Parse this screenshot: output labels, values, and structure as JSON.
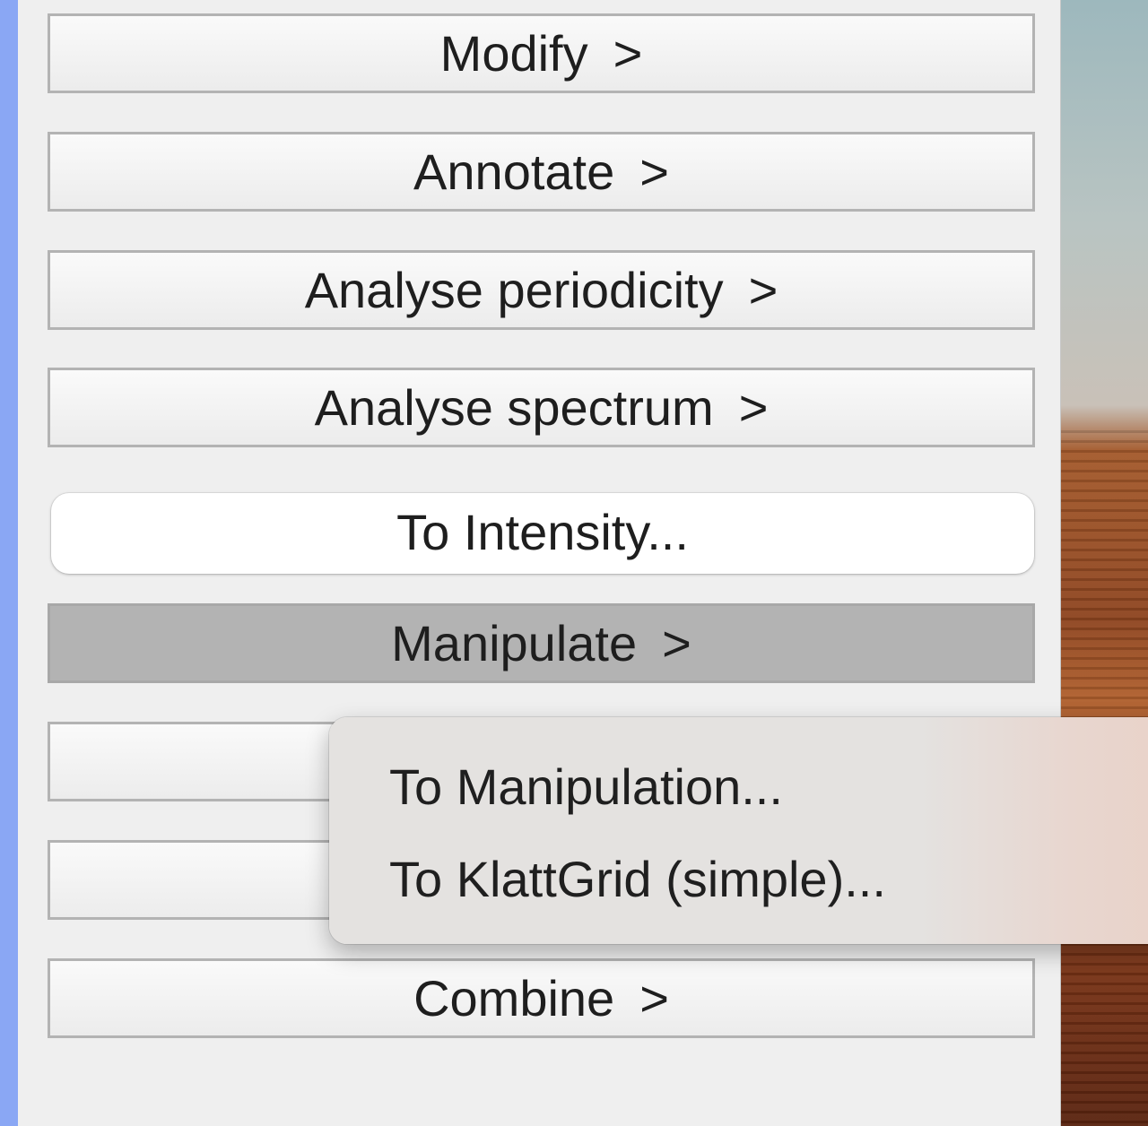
{
  "panel": {
    "buttons": [
      {
        "label": "Modify",
        "arrow": ">"
      },
      {
        "label": "Annotate",
        "arrow": ">"
      },
      {
        "label": "Analyse periodicity",
        "arrow": ">"
      },
      {
        "label": "Analyse spectrum",
        "arrow": ">"
      },
      {
        "label": "To Intensity...",
        "arrow": ""
      },
      {
        "label": "Manipulate",
        "arrow": ">"
      },
      {
        "label": "",
        "arrow": ""
      },
      {
        "label": "",
        "arrow": ""
      },
      {
        "label": "Combine",
        "arrow": ">"
      }
    ],
    "active_button": "Manipulate"
  },
  "menu": {
    "items": [
      {
        "label": "To Manipulation..."
      },
      {
        "label": "To KlattGrid (simple)..."
      }
    ]
  },
  "colors": {
    "focus_strip": "#8aa7f4",
    "panel_bg": "#efefef",
    "button_border": "#b3b3b3",
    "active_button_bg": "#b3b3b3"
  }
}
